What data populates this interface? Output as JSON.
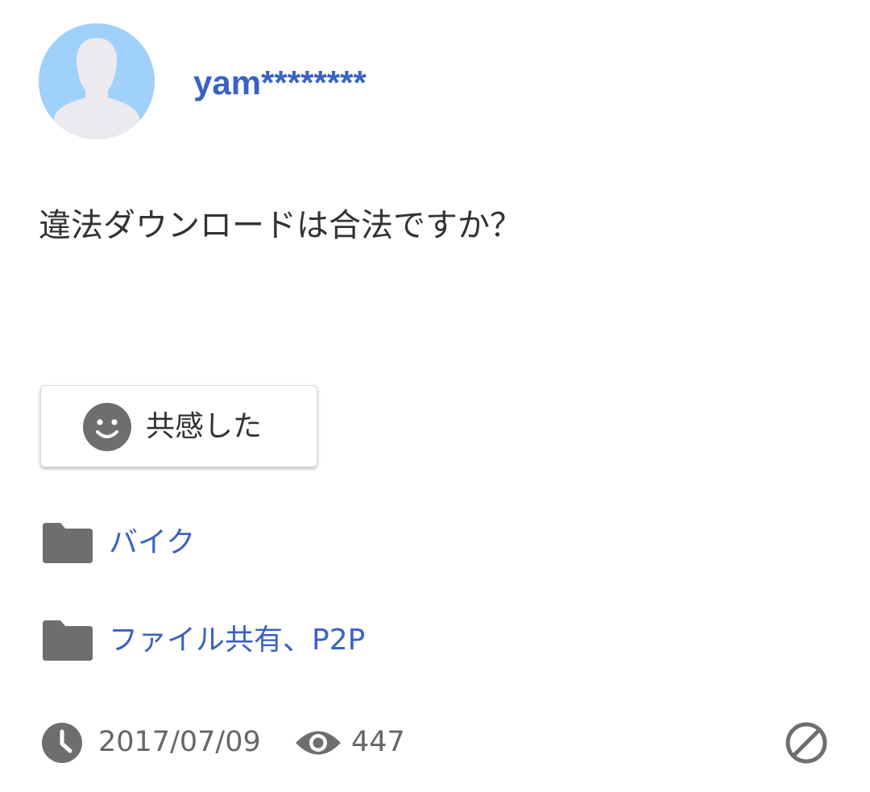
{
  "post": {
    "username": "yam********",
    "question": "違法ダウンロードは合法ですか？"
  },
  "empathy": {
    "label": "共感した",
    "icon": "smile-icon"
  },
  "categories": [
    {
      "label": "バイク",
      "icon": "folder-icon"
    },
    {
      "label": "ファイル共有、P2P",
      "icon": "folder-icon"
    }
  ],
  "meta": {
    "date": "2017/07/09",
    "views": "447",
    "clock_icon": "clock-icon",
    "views_icon": "eye-icon",
    "report_icon": "block-icon"
  },
  "colors": {
    "link": "#3a62c4",
    "icon_gray": "#6e6e6e",
    "avatar_bg": "#9fd1fb"
  }
}
